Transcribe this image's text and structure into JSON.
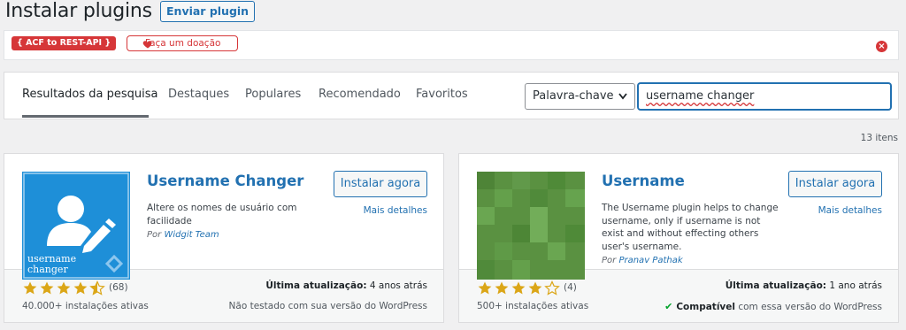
{
  "header": {
    "title": "Instalar plugins",
    "upload_button": "Enviar plugin"
  },
  "notice": {
    "acf_badge": "{ ACF to REST-API }",
    "donate_label": "Faça um doação"
  },
  "filter": {
    "tabs": [
      "Resultados da pesquisa",
      "Destaques",
      "Populares",
      "Recomendado",
      "Favoritos"
    ],
    "search_type": "Palavra-chave",
    "search_value": "username changer"
  },
  "results_count": "13 itens",
  "plugins": [
    {
      "name": "Username Changer",
      "install_label": "Instalar agora",
      "more_details": "Mais detalhes",
      "description": "Altere os nomes de usuário com facilidade",
      "author_prefix": "Por",
      "author": "Widgit Team",
      "rating_stars": 4.5,
      "rating_count": "(68)",
      "installs": "40.000+ instalações ativas",
      "updated_label": "Última atualização:",
      "updated_value": "4 anos atrás",
      "compat": "Não testado com sua versão do WordPress",
      "icon_text_line1": "username",
      "icon_text_line2": "changer",
      "icon_color": "#1e8fd8"
    },
    {
      "name": "Username",
      "install_label": "Instalar agora",
      "more_details": "Mais detalhes",
      "description": "The Username plugin helps to change username, only if username is not exist and without effecting others user's username.",
      "author_prefix": "Por",
      "author": "Pranav Pathak",
      "rating_stars": 4,
      "rating_count": "(4)",
      "installs": "500+ instalações ativas",
      "updated_label": "Última atualização:",
      "updated_value": "1 ano atrás",
      "compat_strong": "Compatível",
      "compat_rest": "com essa versão do WordPress",
      "icon_color": "#5a9141"
    }
  ],
  "colors": {
    "link": "#2271b1",
    "star": "#dba617",
    "danger": "#d63638",
    "success": "#00a32a"
  }
}
